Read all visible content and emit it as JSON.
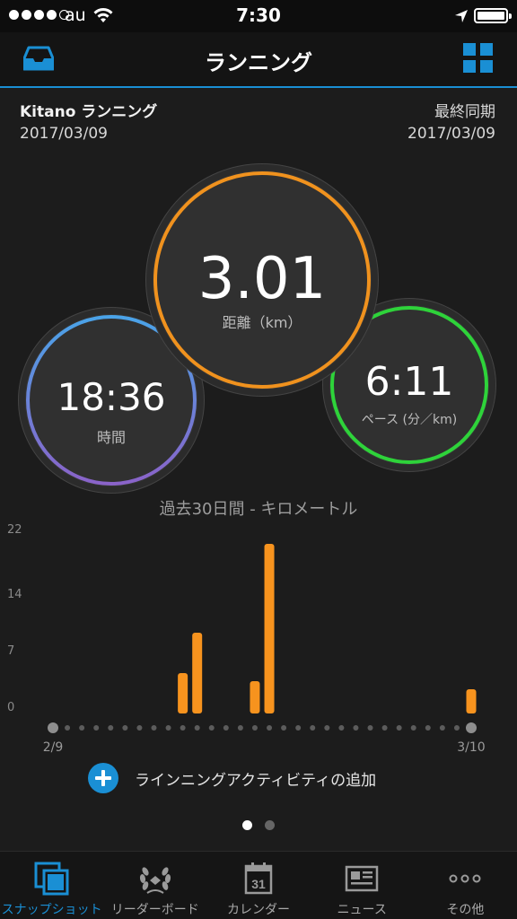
{
  "status_bar": {
    "carrier": "au",
    "time": "7:30",
    "signal_bars_filled": 4,
    "signal_bars_total": 5,
    "battery_level": 1.0
  },
  "nav": {
    "title": "ランニング",
    "left_icon": "inbox-icon",
    "right_icon": "grid-icon"
  },
  "activity": {
    "name": "Kitano ランニング",
    "date": "2017/03/09",
    "sync_label": "最終同期",
    "sync_date": "2017/03/09"
  },
  "metrics": {
    "distance": {
      "value": "3.01",
      "label": "距離（km）",
      "color": "#f0921e"
    },
    "time": {
      "value": "18:36",
      "label": "時間",
      "color_start": "#4aa3e8",
      "color_end": "#8a63c9"
    },
    "pace": {
      "value": "6:11",
      "label": "ペース (分／km)",
      "color": "#2ed33a"
    }
  },
  "chart": {
    "title": "過去30日間 - キロメートル",
    "x_start_label": "2/9",
    "x_end_label": "3/10"
  },
  "chart_data": {
    "type": "bar",
    "title": "過去30日間 - キロメートル",
    "yticks": [
      "22",
      "14",
      "7",
      "0"
    ],
    "ytick_values": [
      22,
      14,
      7,
      0
    ],
    "ylim": [
      0,
      22
    ],
    "x_range": [
      "2/9",
      "3/10"
    ],
    "num_days": 30,
    "values": [
      0,
      0,
      0,
      0,
      0,
      0,
      0,
      0,
      0,
      5,
      10,
      0,
      0,
      0,
      4,
      21,
      0,
      0,
      0,
      0,
      0,
      0,
      0,
      0,
      0,
      0,
      0,
      0,
      0,
      3
    ],
    "bar_color": "#f7931e",
    "grid": false
  },
  "add_activity": {
    "label": "ラインニングアクティビティの追加"
  },
  "pager": {
    "pages": 2,
    "current": 1
  },
  "tabs": [
    {
      "label": "スナップショット",
      "icon": "snapshot-icon",
      "active": true
    },
    {
      "label": "リーダーボード",
      "icon": "laurel-icon",
      "active": false
    },
    {
      "label": "カレンダー",
      "icon": "calendar-icon",
      "active": false,
      "icon_text": "31"
    },
    {
      "label": "ニュース",
      "icon": "newspaper-icon",
      "active": false
    },
    {
      "label": "その他",
      "icon": "more-icon",
      "active": false
    }
  ],
  "colors": {
    "accent": "#1a8fd4",
    "background": "#1c1c1c"
  }
}
